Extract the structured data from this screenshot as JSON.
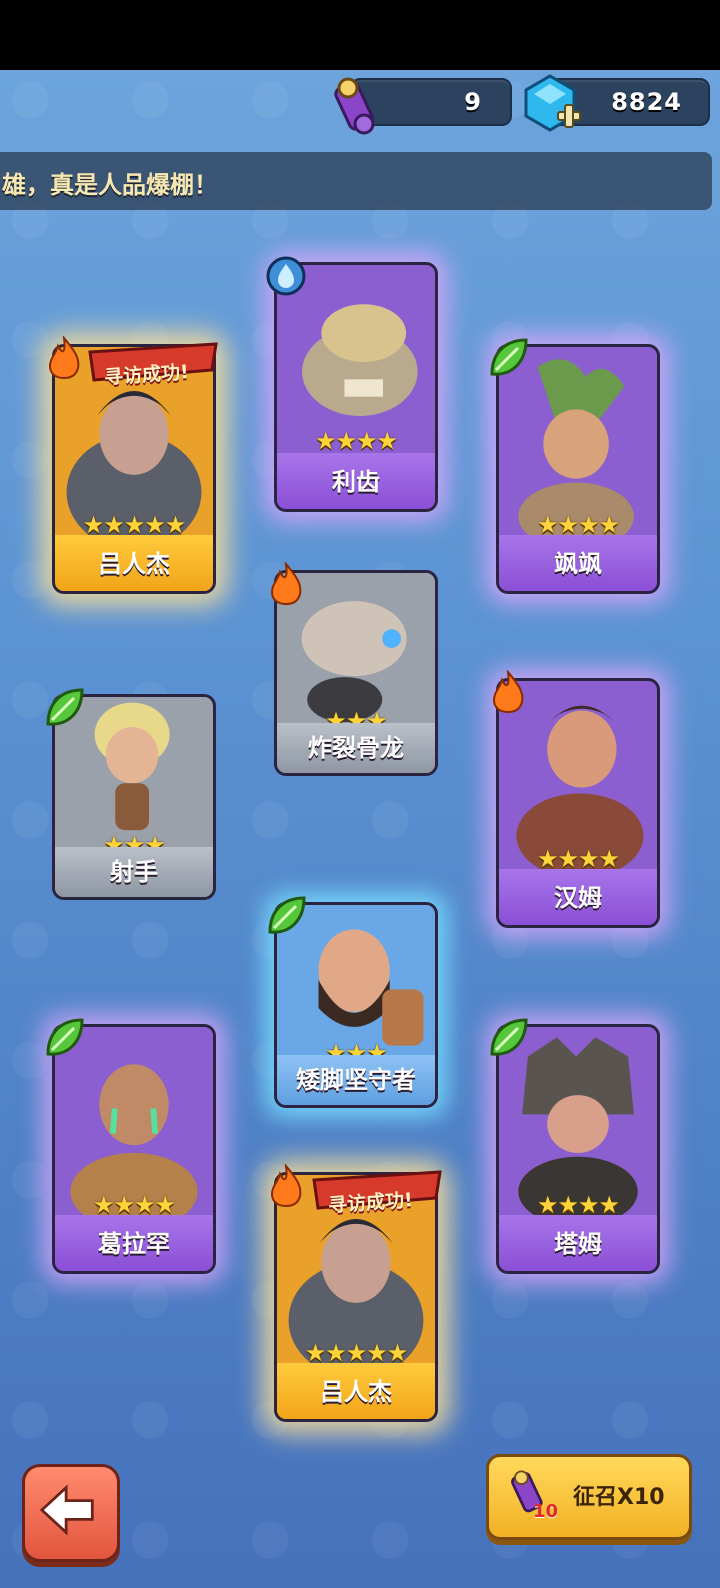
{
  "currency": {
    "scroll_count": "9",
    "gem_count": "8824",
    "scroll_icon": "recruit-scroll-icon",
    "gem_icon": "blue-gem-plus-icon"
  },
  "banner": {
    "text": "雄，真是人品爆棚！"
  },
  "ribbon_text": "寻访成功!",
  "cards": [
    {
      "name": "吕人杰",
      "stars": "★★★★★",
      "element": "fire",
      "rarity": "gold"
    },
    {
      "name": "利齿",
      "stars": "★★★★",
      "element": "water",
      "rarity": "purple"
    },
    {
      "name": "飒飒",
      "stars": "★★★★",
      "element": "leaf",
      "rarity": "purple"
    },
    {
      "name": "炸裂骨龙",
      "stars": "★★★",
      "element": "fire",
      "rarity": "gray"
    },
    {
      "name": "射手",
      "stars": "★★★",
      "element": "leaf",
      "rarity": "gray"
    },
    {
      "name": "汉姆",
      "stars": "★★★★",
      "element": "fire",
      "rarity": "purple"
    },
    {
      "name": "矮脚坚守者",
      "stars": "★★★",
      "element": "leaf",
      "rarity": "blue"
    },
    {
      "name": "葛拉罕",
      "stars": "★★★★",
      "element": "leaf",
      "rarity": "purple"
    },
    {
      "name": "塔姆",
      "stars": "★★★★",
      "element": "leaf",
      "rarity": "purple"
    },
    {
      "name": "吕人杰",
      "stars": "★★★★★",
      "element": "fire",
      "rarity": "gold"
    }
  ],
  "buttons": {
    "back_icon": "arrow-left-icon",
    "recruit_label": "征召X10",
    "recruit_badge": "10"
  },
  "colors": {
    "background": "#5c93d3",
    "gold_card": "#f2a419",
    "purple_card": "#8a4fd6",
    "gray_card": "#8f97a3",
    "blue_card": "#5f9fe0",
    "star": "#ffd43a"
  }
}
